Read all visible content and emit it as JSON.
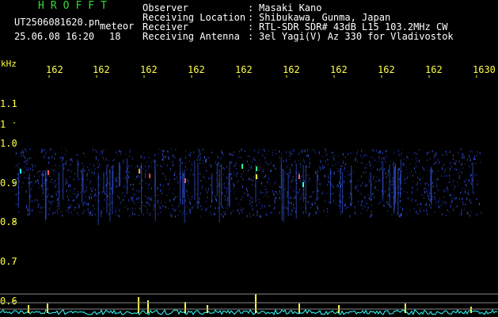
{
  "header": {
    "title": "HROFFT",
    "filename": "UT2506081620.pn",
    "tag": "meteor",
    "datetime": "25.06.08 16:20",
    "minute": "18",
    "info": [
      {
        "label": "Observer",
        "value": "Masaki Kano"
      },
      {
        "label": "Receiving Location",
        "value": "Shibukawa, Gunma, Japan"
      },
      {
        "label": "Receiver",
        "value": "RTL-SDR SDR# 43dB L15 103.2MHz CW"
      },
      {
        "label": "Receiving Antenna",
        "value": "3el Yagi(V) Az 330 for Vladivostok"
      }
    ],
    "colon": ":"
  },
  "axes": {
    "unit": "kHz",
    "x_ticks": [
      "162",
      "162",
      "162",
      "162",
      "162",
      "162",
      "162",
      "162",
      "162",
      "1630"
    ],
    "y_ticks": [
      "1.1",
      "1",
      "1.0",
      "0.9",
      "0.8",
      "0.7",
      "0.6"
    ]
  },
  "colors": {
    "background": "#000000",
    "title": "#33dd33",
    "label": "#ffffff",
    "axis": "#ffff44",
    "noise": "#2233aa",
    "signal": "#ff4444",
    "trace": "#33ffff"
  }
}
